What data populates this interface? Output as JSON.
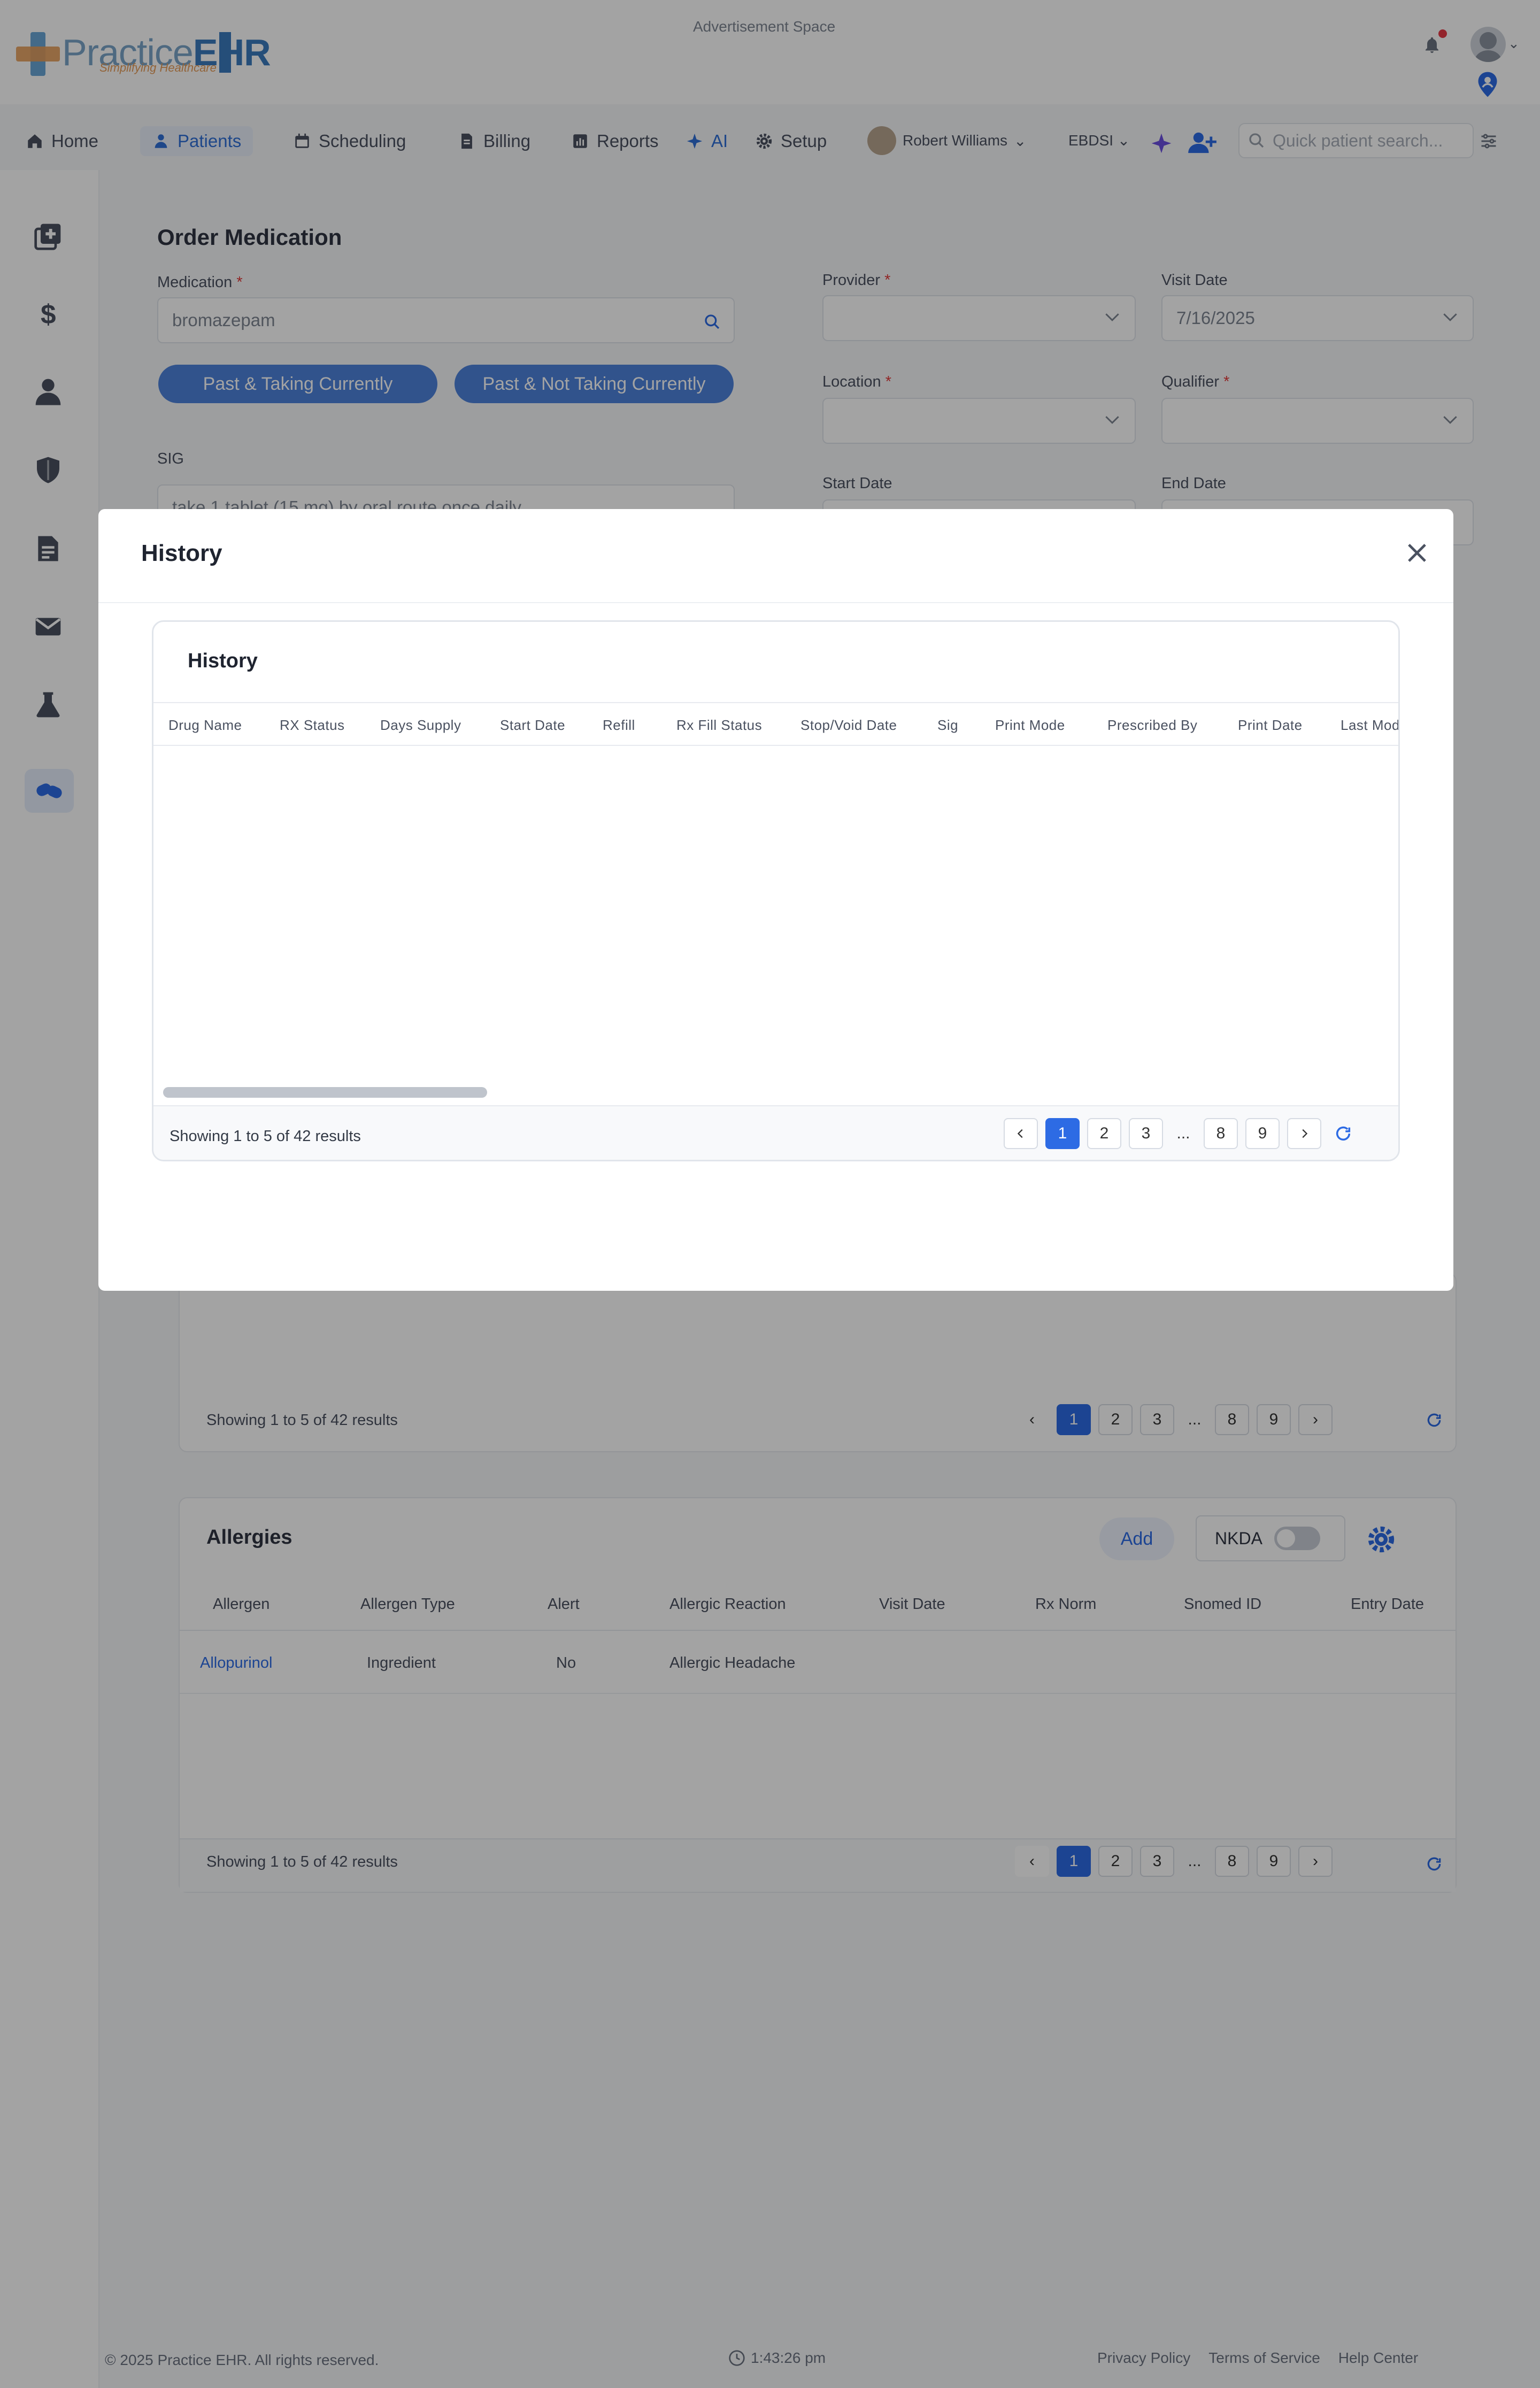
{
  "header": {
    "logo_main": "Practice",
    "logo_bold": "EHR",
    "logo_tag": "Simplifying Healthcare",
    "ad_space": "Advertisement Space"
  },
  "nav": {
    "items": [
      {
        "label": "Home",
        "icon": "home-icon"
      },
      {
        "label": "Patients",
        "icon": "patient-icon"
      },
      {
        "label": "Scheduling",
        "icon": "calendar-icon"
      },
      {
        "label": "Billing",
        "icon": "billing-icon"
      },
      {
        "label": "Reports",
        "icon": "reports-icon"
      },
      {
        "label": "AI",
        "icon": "sparkle-icon"
      },
      {
        "label": "Setup",
        "icon": "gear-icon"
      }
    ],
    "user_name": "Robert Williams",
    "org": "EBDSI",
    "quick_search_placeholder": "Quick patient search..."
  },
  "order": {
    "title": "Order Medication",
    "medication_label": "Medication",
    "medication_value": "bromazepam",
    "pill_1": "Past & Taking Currently",
    "pill_2": "Past & Not Taking Currently",
    "sig_label": "SIG",
    "sig_value": "take 1 tablet (15 mg) by oral route once daily",
    "provider_label": "Provider",
    "visit_date_label": "Visit Date",
    "visit_date_value": "7/16/2025",
    "location_label": "Location",
    "qualifier_label": "Qualifier",
    "start_date_label": "Start Date",
    "end_date_label": "End Date",
    "required_mark": "*"
  },
  "medications_pager": {
    "showing": "Showing 1 to 5 of 42 results",
    "pages": [
      "1",
      "2",
      "3",
      "...",
      "8",
      "9"
    ]
  },
  "allergies": {
    "title": "Allergies",
    "add_label": "Add",
    "nkda_label": "NKDA",
    "columns": [
      "Allergen",
      "Allergen Type",
      "Alert",
      "Allergic Reaction",
      "Visit Date",
      "Rx Norm",
      "Snomed ID",
      "Entry Date"
    ],
    "rows": [
      {
        "allergen": "Allopurinol",
        "type": "Ingredient",
        "alert": "No",
        "reaction": "Allergic Headache"
      }
    ],
    "showing": "Showing 1 to 5 of 42 results",
    "pages": [
      "1",
      "2",
      "3",
      "...",
      "8",
      "9"
    ]
  },
  "modal": {
    "title": "History",
    "card_title": "History",
    "columns": [
      "Drug Name",
      "RX Status",
      "Days Supply",
      "Start Date",
      "Refill",
      "Rx Fill Status",
      "Stop/Void Date",
      "Sig",
      "Print Mode",
      "Prescribed By",
      "Print Date",
      "Last Mod"
    ],
    "showing": "Showing 1 to 5 of 42 results",
    "pages": [
      "1",
      "2",
      "3",
      "...",
      "8",
      "9"
    ]
  },
  "footer": {
    "copyright": "© 2025 Practice EHR. All rights reserved.",
    "time": "1:43:26 pm",
    "links": [
      "Privacy Policy",
      "Terms of Service",
      "Help Center"
    ]
  },
  "colors": {
    "primary": "#2d6be4",
    "overlay": "rgba(0,0,0,0.36)",
    "required": "#e23b3b"
  }
}
